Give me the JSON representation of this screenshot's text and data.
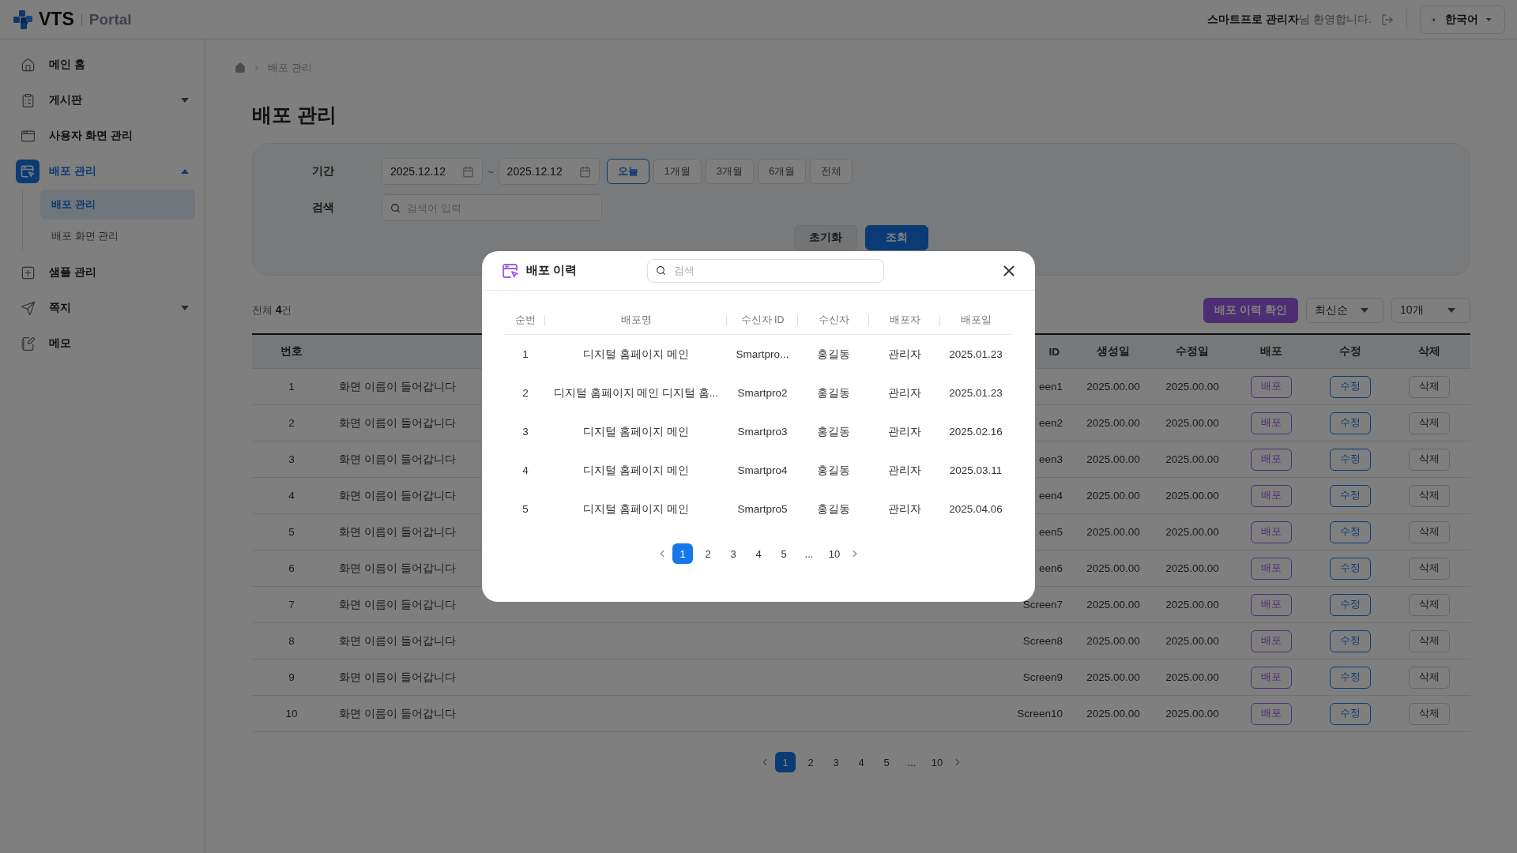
{
  "header": {
    "logo": "VTS",
    "product": "Portal",
    "welcome": "**스마트프로 관리자**님 환영합니다.",
    "language": "한국어"
  },
  "sidebar": {
    "items": [
      {
        "label": "메인 홈",
        "selected": false
      },
      {
        "label": "게시판",
        "selected": false,
        "expanded": false
      },
      {
        "label": "사용자 화면 관리",
        "selected": false
      },
      {
        "label": "배포 관리",
        "selected": true,
        "expanded": true,
        "children": [
          {
            "label": "배포 관리",
            "selected": true
          },
          {
            "label": "배포 화면 관리",
            "selected": false
          }
        ]
      },
      {
        "label": "샘플 관리",
        "selected": false
      },
      {
        "label": "쪽지",
        "selected": false,
        "expanded": false
      },
      {
        "label": "메모",
        "selected": false
      }
    ]
  },
  "breadcrumb": [
    "배포 관리"
  ],
  "title": "배포 관리",
  "filter": {
    "period_label": "기간",
    "date_from": "2025.12.12",
    "separator": "~",
    "date_to": "2025.12.12",
    "periods": [
      {
        "label": "오늘",
        "selected": true
      },
      {
        "label": "1개월",
        "selected": false
      },
      {
        "label": "3개월",
        "selected": false
      },
      {
        "label": "6개월",
        "selected": false
      },
      {
        "label": "전체",
        "selected": false
      }
    ],
    "search_label": "검색",
    "search_placeholder": "검색어 입력",
    "buttons": [
      {
        "label": "초기화",
        "kind": "secondary"
      },
      {
        "label": "조회",
        "kind": "primary"
      }
    ]
  },
  "list": {
    "total": "전체 **4**건",
    "history_button": "배포 이력 확인",
    "sort": "최신순",
    "page_size": "10개"
  },
  "table": {
    "columns": [
      "번호",
      "ID",
      "생성일",
      "수정일",
      "배포",
      "수정",
      "삭제"
    ],
    "rows": [
      {
        "no": "1",
        "name": "화면 이름이 들어갑니다",
        "id": "een1",
        "created": "2025.00.00",
        "modified": "2025.00.00",
        "deploy": "배포",
        "edit": "수정",
        "delete": "삭제"
      },
      {
        "no": "2",
        "name": "화면 이름이 들어갑니다",
        "id": "een2",
        "created": "2025.00.00",
        "modified": "2025.00.00",
        "deploy": "배포",
        "edit": "수정",
        "delete": "삭제"
      },
      {
        "no": "3",
        "name": "화면 이름이 들어갑니다",
        "id": "een3",
        "created": "2025.00.00",
        "modified": "2025.00.00",
        "deploy": "배포",
        "edit": "수정",
        "delete": "삭제"
      },
      {
        "no": "4",
        "name": "화면 이름이 들어갑니다",
        "id": "een4",
        "created": "2025.00.00",
        "modified": "2025.00.00",
        "deploy": "배포",
        "edit": "수정",
        "delete": "삭제"
      },
      {
        "no": "5",
        "name": "화면 이름이 들어갑니다",
        "id": "een5",
        "created": "2025.00.00",
        "modified": "2025.00.00",
        "deploy": "배포",
        "edit": "수정",
        "delete": "삭제"
      },
      {
        "no": "6",
        "name": "화면 이름이 들어갑니다",
        "id": "een6",
        "created": "2025.00.00",
        "modified": "2025.00.00",
        "deploy": "배포",
        "edit": "수정",
        "delete": "삭제"
      },
      {
        "no": "7",
        "name": "화면 이름이 들어갑니다",
        "id": "Screen7",
        "created": "2025.00.00",
        "modified": "2025.00.00",
        "deploy": "배포",
        "edit": "수정",
        "delete": "삭제"
      },
      {
        "no": "8",
        "name": "화면 이름이 들어갑니다",
        "id": "Screen8",
        "created": "2025.00.00",
        "modified": "2025.00.00",
        "deploy": "배포",
        "edit": "수정",
        "delete": "삭제"
      },
      {
        "no": "9",
        "name": "화면 이름이 들어갑니다",
        "id": "Screen9",
        "created": "2025.00.00",
        "modified": "2025.00.00",
        "deploy": "배포",
        "edit": "수정",
        "delete": "삭제"
      },
      {
        "no": "10",
        "name": "화면 이름이 들어갑니다",
        "id": "Screen10",
        "created": "2025.00.00",
        "modified": "2025.00.00",
        "deploy": "배포",
        "edit": "수정",
        "delete": "삭제"
      }
    ],
    "pagination": [
      {
        "label": "1",
        "selected": true
      },
      {
        "label": "2",
        "selected": false
      },
      {
        "label": "3",
        "selected": false
      },
      {
        "label": "4",
        "selected": false
      },
      {
        "label": "5",
        "selected": false
      },
      {
        "label": "...",
        "selected": false
      },
      {
        "label": "10",
        "selected": false
      }
    ]
  },
  "modal": {
    "title": "배포 이력",
    "search_placeholder": "검색",
    "columns": [
      "순번",
      "배포명",
      "수신자 ID",
      "수신자",
      "배포자",
      "배포일"
    ],
    "rows": [
      [
        "1",
        "디지털 홈페이지 메인",
        "Smartpro...",
        "홍길동",
        "관리자",
        "2025.01.23"
      ],
      [
        "2",
        "디지털 홈페이지 메인 디지털 홈...",
        "Smartpro2",
        "홍길동",
        "관리자",
        "2025.01.23"
      ],
      [
        "3",
        "디지털 홈페이지 메인",
        "Smartpro3",
        "홍길동",
        "관리자",
        "2025.02.16"
      ],
      [
        "4",
        "디지털 홈페이지 메인",
        "Smartpro4",
        "홍길동",
        "관리자",
        "2025.03.11"
      ],
      [
        "5",
        "디지털 홈페이지 메인",
        "Smartpro5",
        "홍길동",
        "관리자",
        "2025.04.06"
      ]
    ],
    "pagination": [
      {
        "label": "1",
        "selected": true
      },
      {
        "label": "2",
        "selected": false
      },
      {
        "label": "3",
        "selected": false
      },
      {
        "label": "4",
        "selected": false
      },
      {
        "label": "5",
        "selected": false
      },
      {
        "label": "...",
        "selected": false
      },
      {
        "label": "10",
        "selected": false
      }
    ]
  }
}
